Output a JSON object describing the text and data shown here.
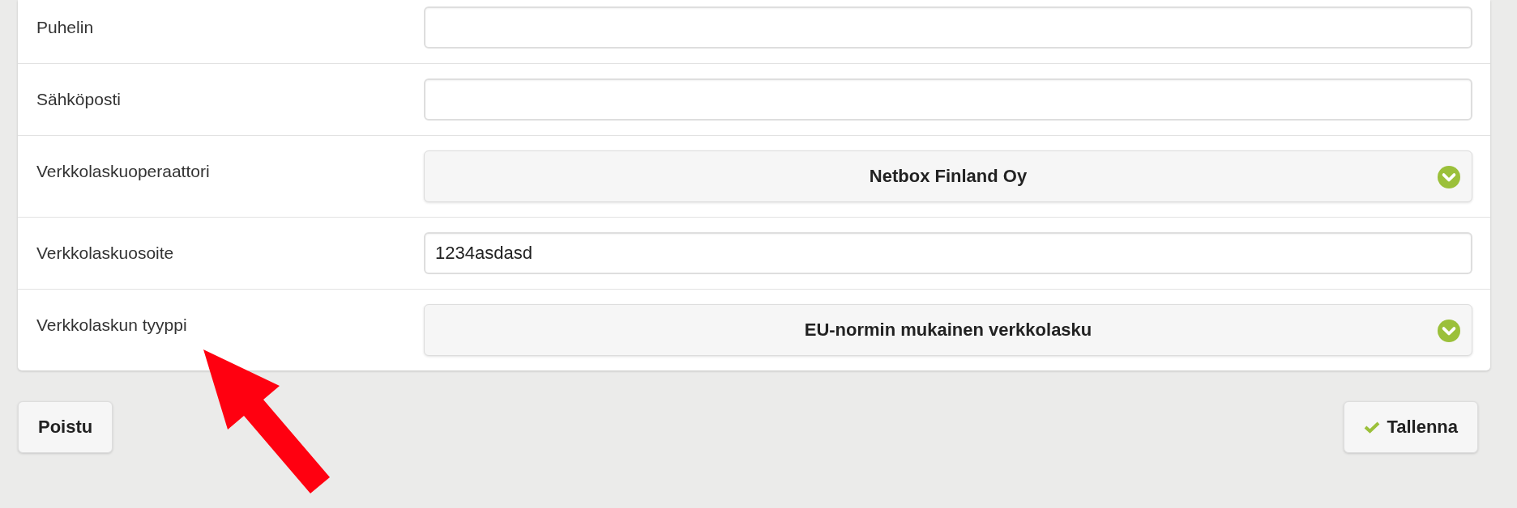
{
  "fields": [
    {
      "label": "Puhelin",
      "kind": "input"
    },
    {
      "label": "Sähköposti",
      "kind": "input"
    },
    {
      "label": "Verkkolaskuoperaattori",
      "kind": "select",
      "value": "Netbox Finland Oy"
    },
    {
      "label": "Verkkolaskuosoite",
      "kind": "input",
      "value": "1234asdasd"
    },
    {
      "label": "Verkkolaskun tyyppi",
      "kind": "select",
      "value": "EU-normin mukainen verkkolasku"
    }
  ],
  "buttons": {
    "exit": "Poistu",
    "save": "Tallenna"
  }
}
